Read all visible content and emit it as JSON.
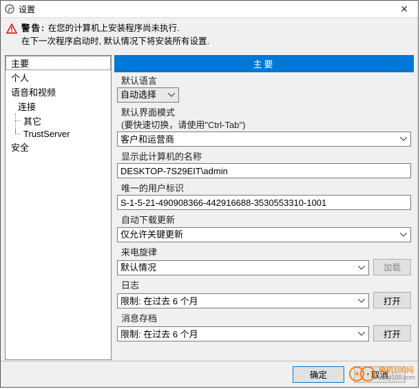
{
  "window": {
    "title": "设置",
    "close": "✕"
  },
  "warning": {
    "prefix": "警告:",
    "line1": "在您的计算机上安装程序尚未执行.",
    "line2": "在下一次程序启动时, 默认情况下将安装所有设置."
  },
  "sidebar": {
    "items": [
      {
        "label": "主要",
        "selected": true
      },
      {
        "label": "个人"
      },
      {
        "label": "语音和视频"
      },
      {
        "label": "连接",
        "children": [
          {
            "label": "其它"
          },
          {
            "label": "TrustServer"
          }
        ]
      },
      {
        "label": "安全"
      }
    ]
  },
  "header": "主要",
  "form": {
    "lang_label": "默认语言",
    "lang_value": "自动选择",
    "mode_label": "默认界面模式",
    "mode_hint": "(要快速切换，请使用\"Ctrl-Tab\")",
    "mode_value": "客户和运营商",
    "name_label": "显示此计算机的名称",
    "name_value": "DESKTOP-7S29EIT\\admin",
    "uid_label": "唯一的用户标识",
    "uid_value": "S-1-5-21-490908366-442916688-3530553310-1001",
    "update_label": "自动下载更新",
    "update_value": "仅允许关键更新",
    "ring_label": "来电旋律",
    "ring_value": "默认情况",
    "ring_btn": "加载",
    "log_label": "日志",
    "log_value": "限制: 在过去 6 个月",
    "log_btn": "打开",
    "archive_label": "消息存档",
    "archive_value": "限制: 在过去 6 个月",
    "archive_btn": "打开"
  },
  "footer": {
    "ok": "确定",
    "cancel": "取消"
  },
  "watermark": {
    "brand": "单机100网",
    "url": "danji100.com"
  }
}
